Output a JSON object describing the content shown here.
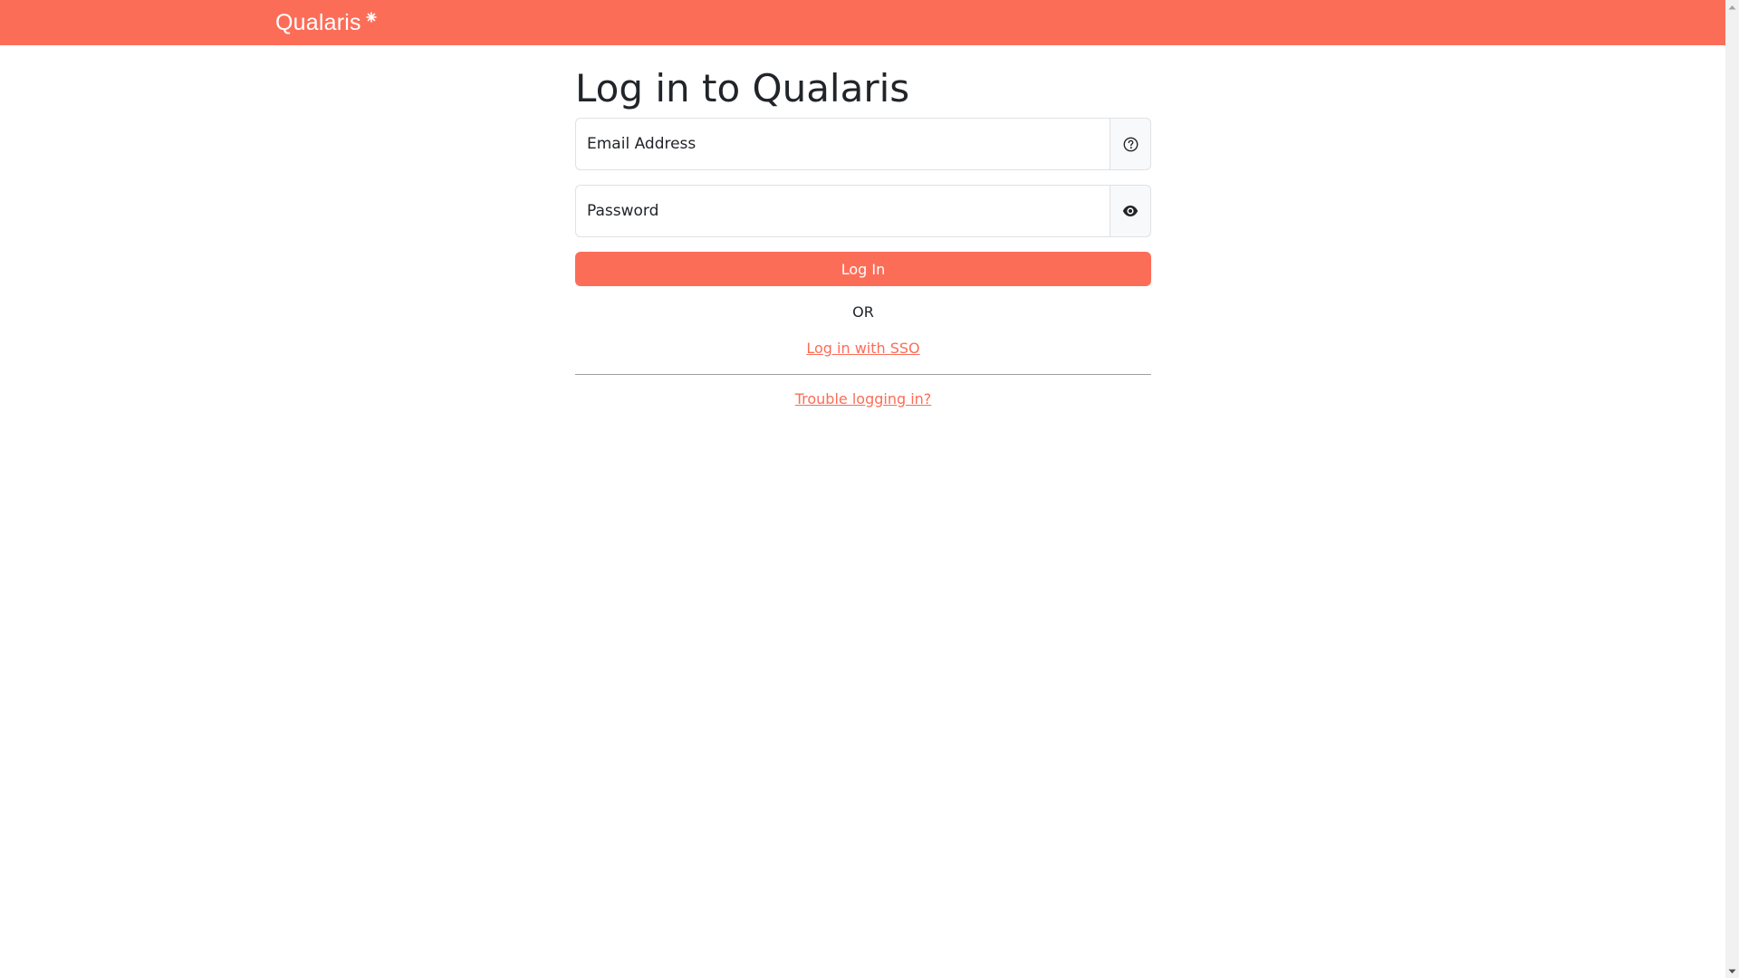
{
  "header": {
    "brand_name": "Qualaris",
    "brand_color": "#fc6d58",
    "brand_mark_icon": "asterisk-icon"
  },
  "login": {
    "title": "Log in to Qualaris",
    "email": {
      "placeholder": "Email Address",
      "value": "",
      "addon_icon": "question-circle-icon"
    },
    "password": {
      "placeholder": "Password",
      "value": "",
      "addon_icon": "eye-icon"
    },
    "submit_label": "Log In",
    "separator_text": "OR",
    "sso_link_label": "Log in with SSO",
    "trouble_link_label": "Trouble logging in?"
  }
}
